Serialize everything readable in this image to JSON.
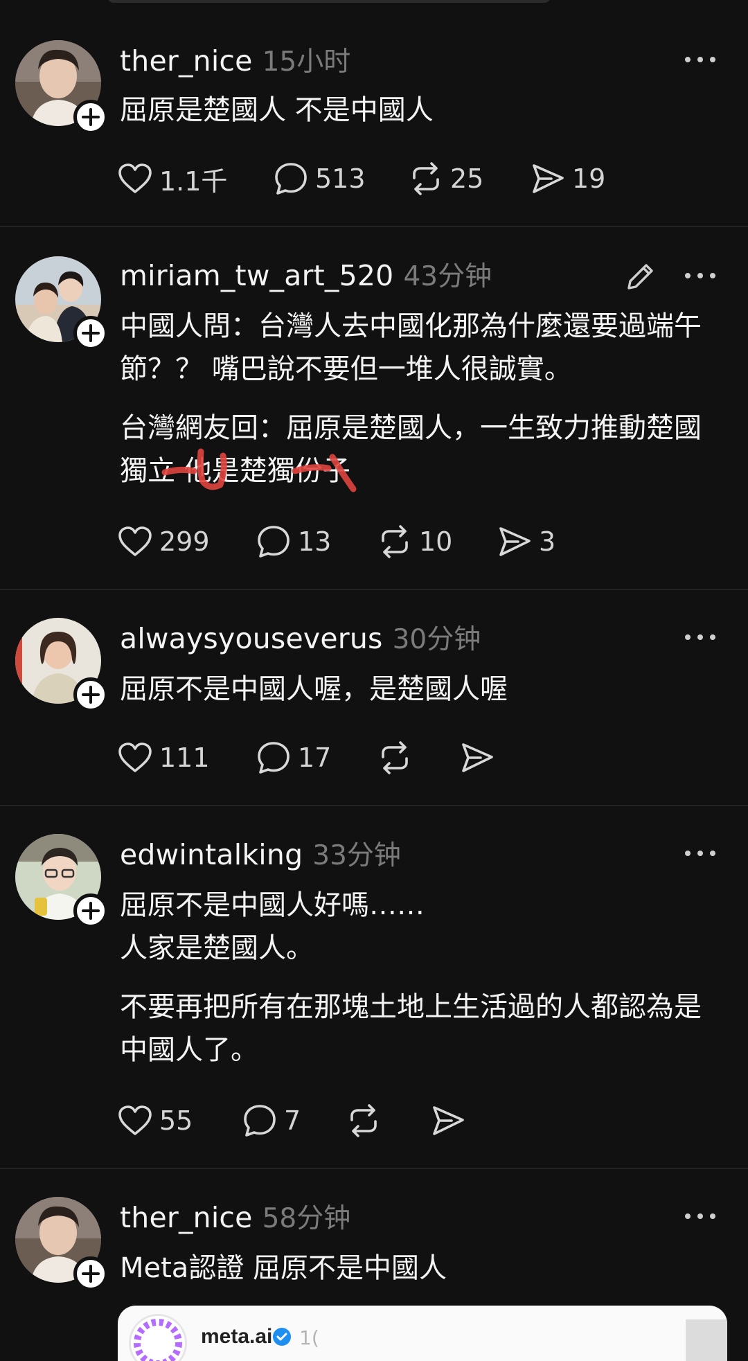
{
  "colors": {
    "background": "#111111",
    "text": "#f4f4f4",
    "muted": "#7b7b7b",
    "scribble": "#e0453f"
  },
  "posts": [
    {
      "username": "ther_nice",
      "time": "15小时",
      "avatar_icon": "person-avatar-icon",
      "paragraphs": [
        "屈原是楚國人 不是中國人"
      ],
      "likes": "1.1千",
      "comments": "513",
      "reposts": "25",
      "shares": "19"
    },
    {
      "username": "miriam_tw_art_520",
      "time": "43分钟",
      "avatar_icon": "couple-avatar-icon",
      "edit_icon": "pencil-icon",
      "paragraphs": [
        "中國人問：台灣人去中國化那為什麼還要過端午節？？ 嘴巴說不要但一堆人很誠實。",
        "台灣網友回：屈原是楚國人，一生致力推動楚國獨立 他是楚獨份子"
      ],
      "likes": "299",
      "comments": "13",
      "reposts": "10",
      "shares": "3"
    },
    {
      "username": "alwaysyouseverus",
      "time": "30分钟",
      "avatar_icon": "woman-avatar-icon",
      "paragraphs": [
        "屈原不是中國人喔，是楚國人喔"
      ],
      "likes": "111",
      "comments": "17",
      "reposts": "",
      "shares": ""
    },
    {
      "username": "edwintalking",
      "time": "33分钟",
      "avatar_icon": "man-glasses-avatar-icon",
      "paragraphs": [
        "屈原不是中國人好嗎……\n人家是楚國人。",
        "不要再把所有在那塊土地上生活過的人都認為是中國人了。"
      ],
      "likes": "55",
      "comments": "7",
      "reposts": "",
      "shares": ""
    },
    {
      "username": "ther_nice",
      "time": "58分钟",
      "avatar_icon": "person-avatar-icon",
      "paragraphs": [
        "Meta認證 屈原不是中國人"
      ]
    }
  ],
  "embed": {
    "name": "meta.ai",
    "time": "1(",
    "logo_icon": "meta-ai-logo-icon",
    "verified_icon": "verified-badge-icon"
  }
}
